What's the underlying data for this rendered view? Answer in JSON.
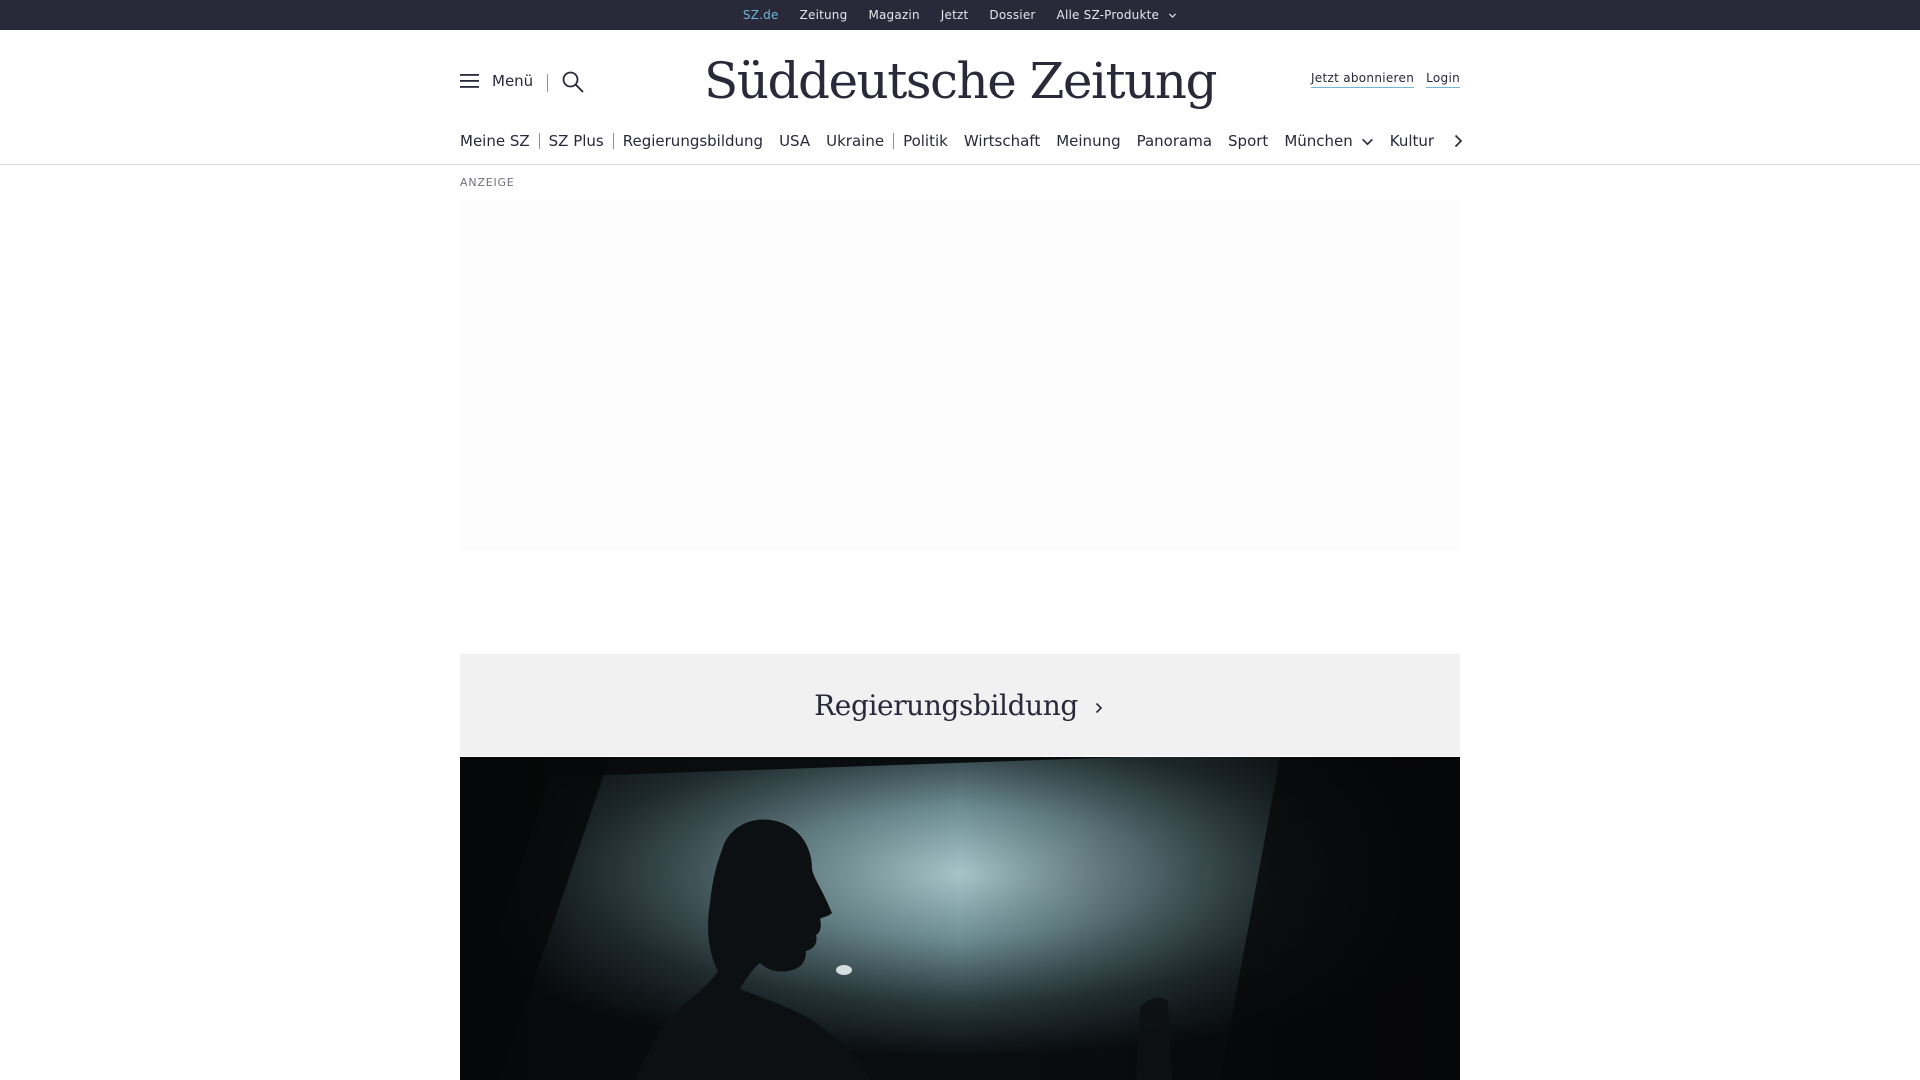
{
  "topbar": {
    "items": [
      {
        "label": "SZ.de"
      },
      {
        "label": "Zeitung"
      },
      {
        "label": "Magazin"
      },
      {
        "label": "Jetzt"
      },
      {
        "label": "Dossier"
      },
      {
        "label": "Alle SZ-Produkte"
      }
    ]
  },
  "header": {
    "menu_label": "Menü",
    "logo_text": "Süddeutsche Zeitung",
    "subscribe_label": "Jetzt abonnieren",
    "login_label": "Login"
  },
  "nav": {
    "items": [
      {
        "label": "Meine SZ"
      },
      {
        "label": "SZ Plus"
      },
      {
        "label": "Regierungsbildung"
      },
      {
        "label": "USA"
      },
      {
        "label": "Ukraine"
      },
      {
        "label": "Politik"
      },
      {
        "label": "Wirtschaft"
      },
      {
        "label": "Meinung"
      },
      {
        "label": "Panorama"
      },
      {
        "label": "Sport"
      },
      {
        "label": "München"
      },
      {
        "label": "Kultur"
      }
    ]
  },
  "ad": {
    "label": "ANZEIGE"
  },
  "topic": {
    "title": "Regierungsbildung"
  },
  "icons": {
    "menu": "hamburger-icon",
    "search": "search-icon",
    "dropdown": "chevron-down-icon",
    "next": "chevron-right-icon"
  },
  "colors": {
    "topbar_bg": "#29293a",
    "accent": "#71b6d8",
    "text": "#29293a",
    "topic_bg": "#f1f1f1"
  }
}
